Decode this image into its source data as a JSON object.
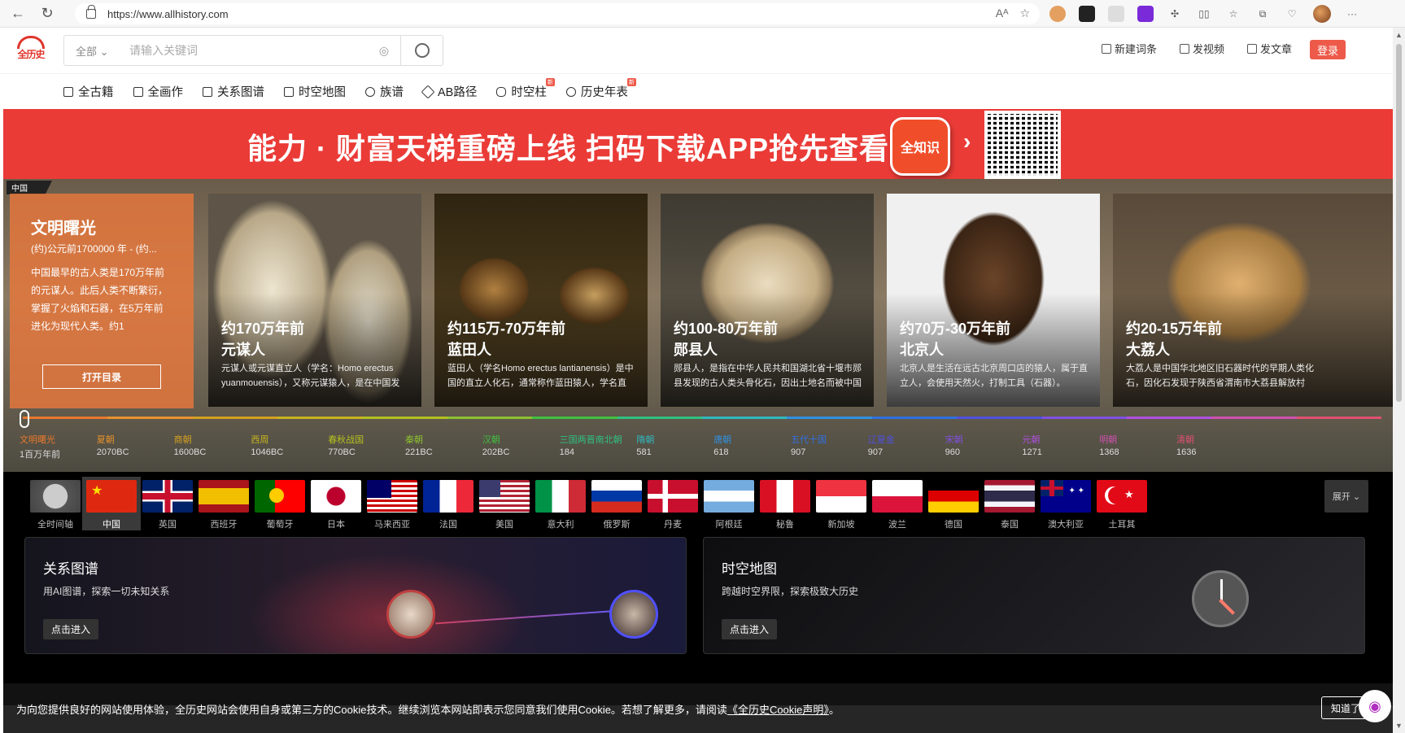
{
  "browser": {
    "url": "https://www.allhistory.com",
    "back_icon": "arrow-left-icon",
    "reload_icon": "reload-icon"
  },
  "header": {
    "logo_text": "全历史",
    "search_scope": "全部 ⌄",
    "search_placeholder": "请输入关键词",
    "actions": [
      "新建词条",
      "发视频",
      "发文章"
    ],
    "login": "登录"
  },
  "subnav": [
    {
      "label": "全古籍",
      "new": false
    },
    {
      "label": "全画作",
      "new": false
    },
    {
      "label": "关系图谱",
      "new": false
    },
    {
      "label": "时空地图",
      "new": false
    },
    {
      "label": "族谱",
      "new": false
    },
    {
      "label": "AB路径",
      "new": false
    },
    {
      "label": "时空柱",
      "new": true
    },
    {
      "label": "历史年表",
      "new": true
    }
  ],
  "new_badge": "新",
  "banner": {
    "headline": "能力 · 财富天梯重磅上线 扫码下载APP抢先查看",
    "app_name": "全知识",
    "arrow": "›",
    "accent": "#ea3b37"
  },
  "hero": {
    "region_tag": "中国",
    "intro": {
      "title": "文明曙光",
      "subtitle": "(约)公元前1700000 年 - (约...",
      "text": "中国最早的古人类是170万年前的元谋人。此后人类不断繁衍，掌握了火焰和石器，在5万年前进化为现代人类。约1",
      "button": "打开目录"
    },
    "cards": [
      {
        "period": "约170万年前",
        "name": "元谋人",
        "desc": "元谋人或元谋直立人（学名：Homo erectus yuanmouensis），又称元谋猿人，是在中国发",
        "img": "#8a7a66"
      },
      {
        "period": "约115万-70万年前",
        "name": "蓝田人",
        "desc": "蓝田人（学名Homo erectus lantianensis）是中国的直立人化石，通常称作蓝田猿人，学名直",
        "img": "#4a3a22"
      },
      {
        "period": "约100-80万年前",
        "name": "郧县人",
        "desc": "郧县人，是指在中华人民共和国湖北省十堰市郧县发现的古人类头骨化石，因出土地名而被中国",
        "img": "#6e6552"
      },
      {
        "period": "约70万-30万年前",
        "name": "北京人",
        "desc": "北京人是生活在远古北京周口店的猿人，属于直立人，会使用天然火，打制工具（石器）。",
        "img": "#dcdcdc"
      },
      {
        "period": "约20-15万年前",
        "name": "大荔人",
        "desc": "大荔人是中国华北地区旧石器时代的早期人类化石，因化石发现于陕西省渭南市大荔县解放村",
        "img": "#a58a5e"
      }
    ]
  },
  "timeline": [
    {
      "name": "文明曙光",
      "date": "1百万年前",
      "color": "#e8782c"
    },
    {
      "name": "夏朝",
      "date": "2070BC",
      "color": "#e8922c"
    },
    {
      "name": "商朝",
      "date": "1600BC",
      "color": "#d4a020"
    },
    {
      "name": "西周",
      "date": "1046BC",
      "color": "#c8b420"
    },
    {
      "name": "春秋战国",
      "date": "770BC",
      "color": "#b4c020"
    },
    {
      "name": "秦朝",
      "date": "221BC",
      "color": "#8cc030"
    },
    {
      "name": "汉朝",
      "date": "202BC",
      "color": "#40c040"
    },
    {
      "name": "三国两晋南北朝",
      "date": "184",
      "color": "#30c080"
    },
    {
      "name": "隋朝",
      "date": "581",
      "color": "#30b8c0"
    },
    {
      "name": "唐朝",
      "date": "618",
      "color": "#3090e0"
    },
    {
      "name": "五代十国",
      "date": "907",
      "color": "#3070e0"
    },
    {
      "name": "辽夏金",
      "date": "907",
      "color": "#5050e0"
    },
    {
      "name": "宋朝",
      "date": "960",
      "color": "#8050e0"
    },
    {
      "name": "元朝",
      "date": "1271",
      "color": "#b050e0"
    },
    {
      "name": "明朝",
      "date": "1368",
      "color": "#d050b0"
    },
    {
      "name": "清朝",
      "date": "1636",
      "color": "#e05070"
    }
  ],
  "countries": {
    "items": [
      "全时间轴",
      "中国",
      "英国",
      "西班牙",
      "葡萄牙",
      "日本",
      "马来西亚",
      "法国",
      "美国",
      "意大利",
      "俄罗斯",
      "丹麦",
      "阿根廷",
      "秘鲁",
      "新加坡",
      "波兰",
      "德国",
      "泰国",
      "澳大利亚",
      "土耳其"
    ],
    "expand": "展开 ⌄"
  },
  "features": [
    {
      "title": "关系图谱",
      "sub": "用AI图谱，探索一切未知关系",
      "button": "点击进入"
    },
    {
      "title": "时空地图",
      "sub": "跨越时空界限，探索极致大历史",
      "button": "点击进入"
    }
  ],
  "cookie": {
    "message": "为向您提供良好的网站使用体验，全历史网站会使用自身或第三方的Cookie技术。继续浏览本网站即表示您同意我们使用Cookie。若想了解更多，请阅读",
    "link": "《全历史Cookie声明》",
    "tail": "。",
    "ok": "知道了"
  }
}
